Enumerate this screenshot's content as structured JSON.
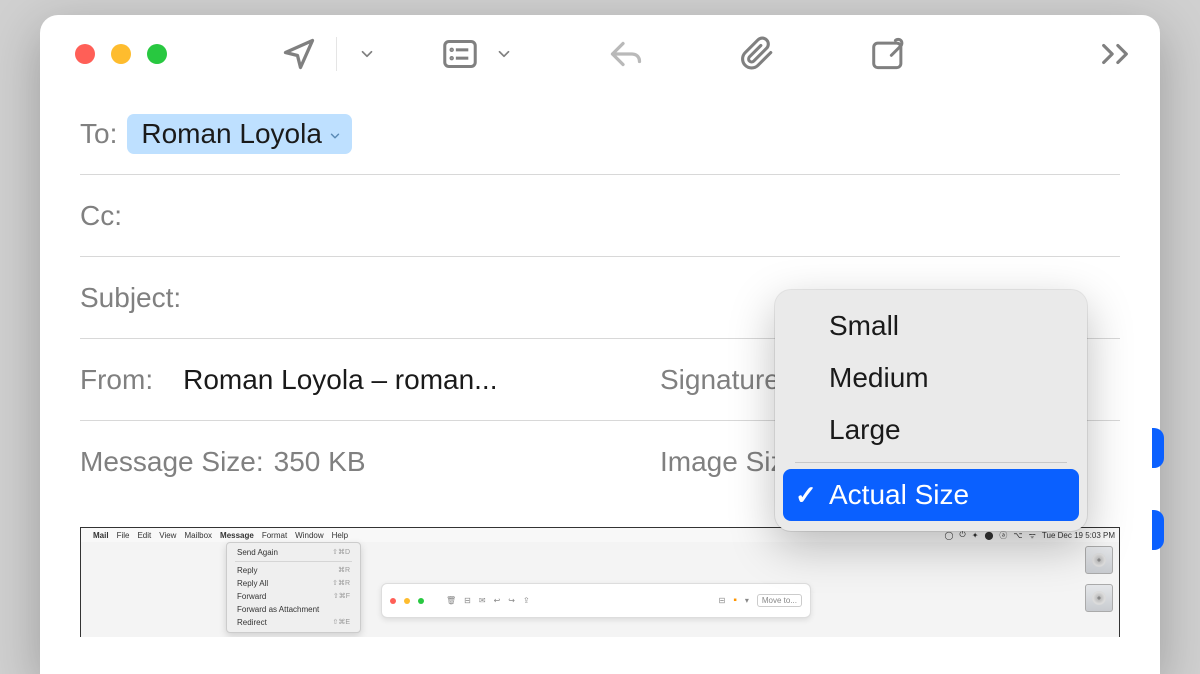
{
  "toolbar": {
    "icons": {
      "send": "send-icon",
      "format": "format-icon",
      "reply": "reply-icon",
      "attach": "attach-icon",
      "markup": "markup-icon",
      "more": "more-icon"
    }
  },
  "fields": {
    "to_label": "To:",
    "to_recipient": "Roman Loyola",
    "cc_label": "Cc:",
    "subject_label": "Subject:",
    "from_label": "From:",
    "from_value": "Roman Loyola – roman...",
    "signature_label": "Signature:",
    "message_size_label": "Message Size:",
    "message_size_value": "350 KB",
    "image_size_label": "Image Size"
  },
  "image_size_menu": {
    "options": [
      "Small",
      "Medium",
      "Large"
    ],
    "selected": "Actual Size"
  },
  "attachment": {
    "menubar": {
      "apple": "",
      "items": [
        "Mail",
        "File",
        "Edit",
        "View",
        "Mailbox",
        "Message",
        "Format",
        "Window",
        "Help"
      ],
      "clock": "Tue Dec 19  5:03 PM"
    },
    "context_menu": {
      "items": [
        {
          "label": "Send Again",
          "shortcut": "⇧⌘D"
        },
        {
          "label": "Reply",
          "shortcut": "⌘R"
        },
        {
          "label": "Reply All",
          "shortcut": "⇧⌘R"
        },
        {
          "label": "Forward",
          "shortcut": "⇧⌘F"
        },
        {
          "label": "Forward as Attachment",
          "shortcut": ""
        },
        {
          "label": "Redirect",
          "shortcut": "⇧⌘E"
        }
      ]
    },
    "mini_window": {
      "move_to": "Move to..."
    }
  }
}
